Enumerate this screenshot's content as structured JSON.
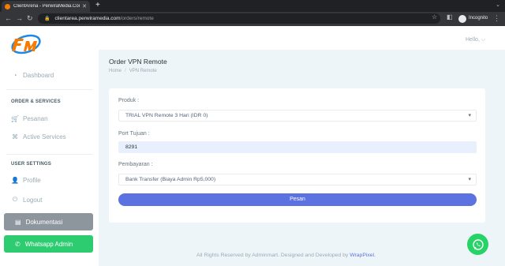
{
  "browser": {
    "tab_title": "ClientArena - PerwiraMedia.Com",
    "tab_close": "✕",
    "new_tab": "+",
    "url_host": "clientarea.perwiramedia.com",
    "url_path": "/orders/remote",
    "profile": "Incognito"
  },
  "sidebar": {
    "items": [
      {
        "label": "Dashboard",
        "icon": "gauge-icon"
      },
      {
        "label": "Pesanan",
        "icon": "cart-icon"
      },
      {
        "label": "Active Services",
        "icon": "puzzle-icon"
      },
      {
        "label": "Profile",
        "icon": "user-icon"
      },
      {
        "label": "Logout",
        "icon": "power-icon"
      }
    ],
    "heading_orders": "ORDER & SERVICES",
    "heading_user": "USER SETTINGS",
    "btn_docs": "Dokumentasi",
    "btn_whatsapp": "Whatsapp Admin"
  },
  "header": {
    "greeting": "Hello, ⌵"
  },
  "page": {
    "title": "Order VPN Remote",
    "breadcrumb_home": "Home",
    "breadcrumb_sep": "/",
    "breadcrumb_current": "VPN Remote"
  },
  "form": {
    "product_label": "Produk :",
    "product_value": "TRIAL VPN Remote 3 Hari (IDR 0)",
    "port_label": "Port Tujuan :",
    "port_value": "8291",
    "payment_label": "Pembayaran :",
    "payment_value": "Bank Transfer (Biaya Admin Rp5,000)",
    "submit_label": "Pesan"
  },
  "footer": {
    "text": "All Rights Reserved by Adminmart. Designed and Developed by ",
    "link": "WrapPixel."
  },
  "colors": {
    "primary": "#5c72e0",
    "whatsapp": "#2ecc71",
    "docs": "#8d959d",
    "logo_orange": "#f57c00",
    "logo_blue": "#1e88e5"
  }
}
